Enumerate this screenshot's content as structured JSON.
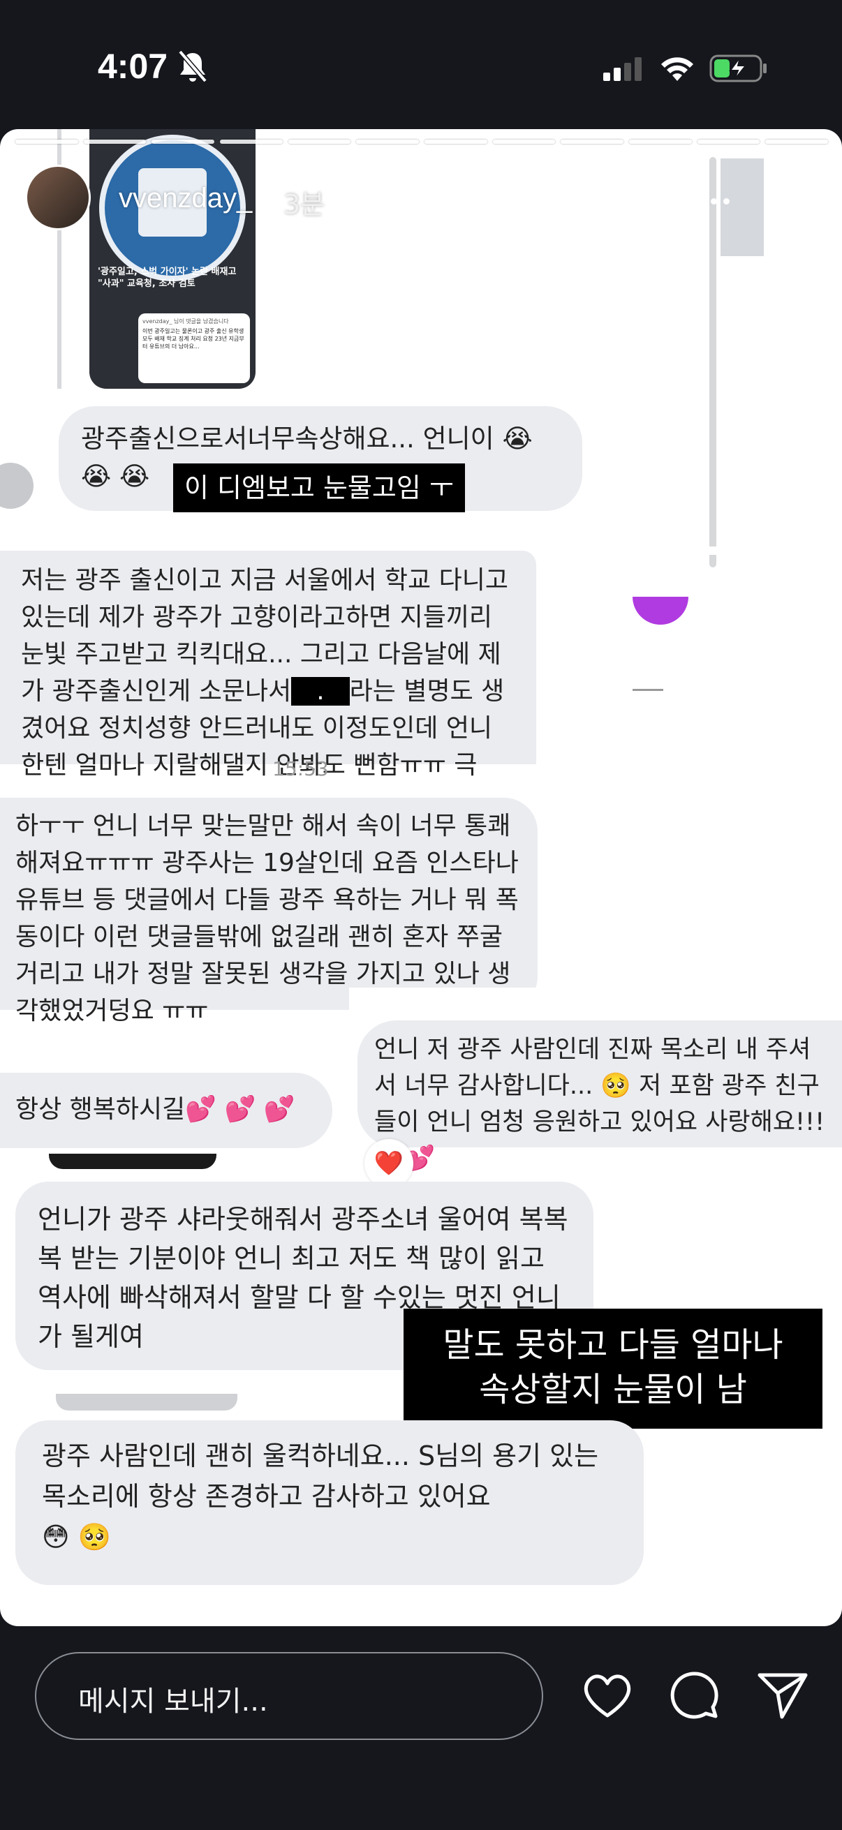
{
  "status_bar": {
    "time": "4:07"
  },
  "story": {
    "username": "vvenzday_",
    "time_ago": "3분",
    "segments": 12
  },
  "thumbnail": {
    "headline": "'광주일고, 스벅 가이자' 논란 배재고 \"사과\" 교육청, 조사 검토",
    "comment_user": "vvenzday_ 님이 댓글을 남겼습니다",
    "comment_text": "이번 광주일고는 물론이고 광주 출신 유학생 모두 배재 학교 징계 처리 요청 23년 지금부터 유튜브의 더 남아요..."
  },
  "messages": {
    "m1_text": "광주출신으로서너무속상해요... 언니이 😭",
    "m1_emoji": "😭 😭",
    "m1_caption": "이 디엠보고 눈물고임 ㅜ",
    "m2_text": "저는 광주 출신이고 지금 서울에서 학교 다니고 있는데 제가 광주가 고향이라고하면 지들끼리 눈빛 주고받고 킥킥대요... 그리고 다음날에 제가 광주출신인게 소문나서",
    "m2_redacted": ".",
    "m2_text_b": "라는 별명도 생겼어요 정치성향 안드러내도 이정도인데 언니한텐 얼마나 지랄해댈지 안봐도 뻔함ㅠㅠ 극",
    "m2_time": "15:53",
    "m3_text": "하ㅜㅜ 언니 너무 맞는말만 해서 속이 너무 통쾌해져요ㅠㅠㅠ 광주사는 19살인데 요즘 인스타나 유튜브 등 댓글에서 다들 광주 욕하는 거나 뭐 폭동이다 이런 댓글들밖에 없길래 괜히 혼자 쭈굴거리고 내가 정말 잘못된 생각을 가지고 있나 생각했었거덩요 ㅠㅠ",
    "m4_text": "언니 저 광주 사람인데 진짜 목소리 내 주셔서 너무 감사합니다... 🥺 저 포함 광주 친구들이 언니 엄청 응원하고 있어요 사랑해요!!! 👭💕",
    "m4_reaction": "❤️",
    "m5_text": "항상 행복하시길💕 💕 💕",
    "m6_text": "언니가 광주 샤라웃해줘서 광주소녀 울어여 복복복 받는 기분이야 언니 최고 저도 책 많이 읽고 역사에 빠삭해져서 할말 다 할 수있는 멋진 언니가 될게여",
    "m6_caption_line1": "말도 못하고 다들 얼마나",
    "m6_caption_line2": "속상할지 눈물이 남",
    "m7_text": "광주 사람인데 괜히 울컥하네요... S님의 용기 있는 목소리에 항상 존경하고 감사하고 있어요",
    "m7_emoji": "😳 🥺"
  },
  "reply_bar": {
    "placeholder": "메시지 보내기..."
  },
  "colors": {
    "background": "#15171d",
    "bubble": "#ebecf0",
    "purple": "#b03be0"
  },
  "icons": [
    "bell-slash-icon",
    "signal-icon",
    "wifi-icon",
    "battery-charging-icon",
    "more-icon",
    "close-icon",
    "heart-icon",
    "comment-icon",
    "send-icon"
  ]
}
